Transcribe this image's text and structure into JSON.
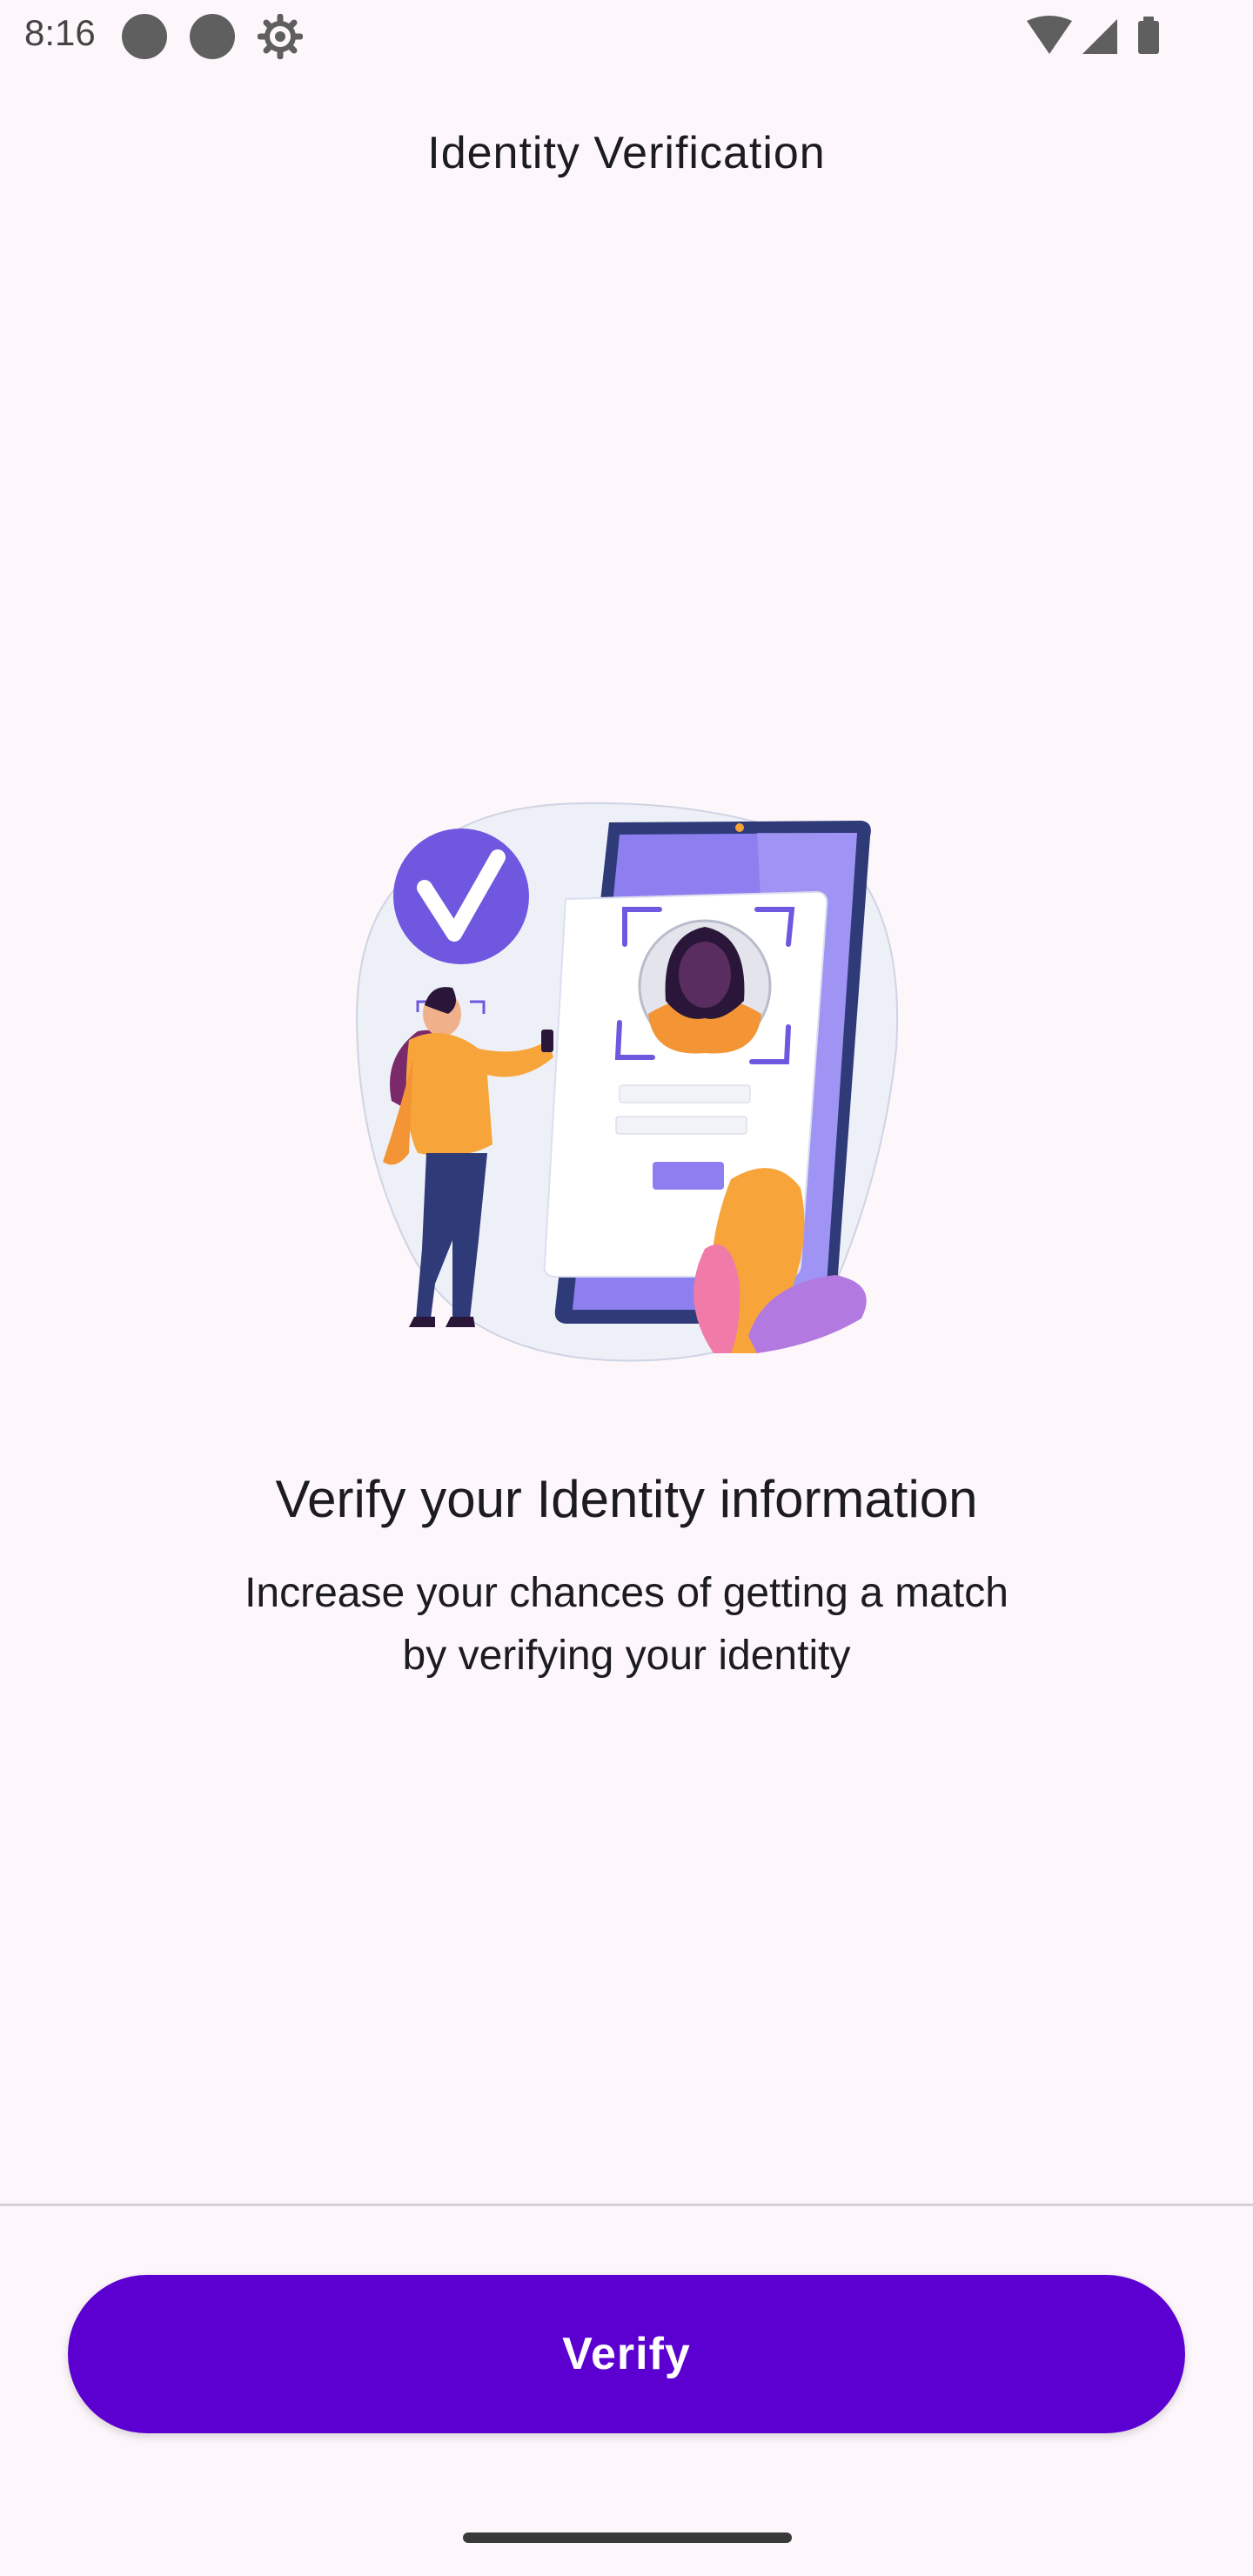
{
  "status_bar": {
    "time": "8:16",
    "icons": [
      "notification-dot-icon",
      "notification-dot-icon",
      "settings-gear-icon",
      "wifi-icon",
      "cellular-signal-icon",
      "battery-icon"
    ]
  },
  "app_bar": {
    "title": "Identity Verification"
  },
  "illustration": {
    "icon": "identity-verification-illustration",
    "colors": {
      "purple": "#6f57e0",
      "orange": "#f7a53a",
      "pink": "#f07aa8",
      "navy": "#2f3a78"
    }
  },
  "content": {
    "headline": "Verify your Identity information",
    "subtitle_line1": "Increase your chances of getting a match",
    "subtitle_line2": "by verifying your identity"
  },
  "actions": {
    "verify_label": "Verify",
    "accent_color": "#5b00d1"
  }
}
